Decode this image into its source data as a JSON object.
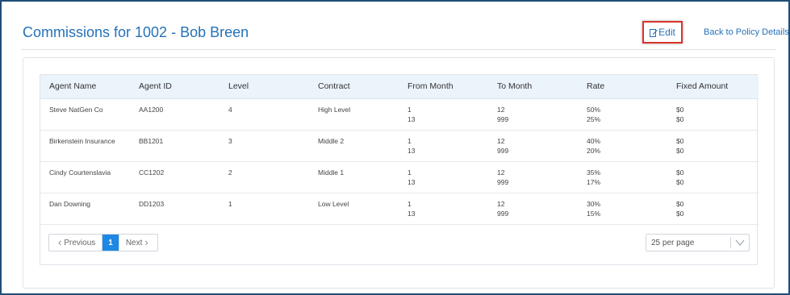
{
  "header": {
    "title": "Commissions for 1002 - Bob Breen",
    "edit_label": "Edit",
    "back_label": "Back to Policy Details"
  },
  "table": {
    "columns": [
      "Agent Name",
      "Agent ID",
      "Level",
      "Contract",
      "From Month",
      "To Month",
      "Rate",
      "Fixed Amount"
    ],
    "rows": [
      {
        "agent_name": "Steve NatGen Co",
        "agent_id": "AA1200",
        "level": "4",
        "contract": "High Level",
        "from": [
          "1",
          "13"
        ],
        "to": [
          "12",
          "999"
        ],
        "rate": [
          "50%",
          "25%"
        ],
        "fixed": [
          "$0",
          "$0"
        ]
      },
      {
        "agent_name": "Birkenstein Insurance",
        "agent_id": "BB1201",
        "level": "3",
        "contract": "Middle 2",
        "from": [
          "1",
          "13"
        ],
        "to": [
          "12",
          "999"
        ],
        "rate": [
          "40%",
          "20%"
        ],
        "fixed": [
          "$0",
          "$0"
        ]
      },
      {
        "agent_name": "Cindy Courtenslavia",
        "agent_id": "CC1202",
        "level": "2",
        "contract": "Middle 1",
        "from": [
          "1",
          "13"
        ],
        "to": [
          "12",
          "999"
        ],
        "rate": [
          "35%",
          "17%"
        ],
        "fixed": [
          "$0",
          "$0"
        ]
      },
      {
        "agent_name": "Dan Downing",
        "agent_id": "DD1203",
        "level": "1",
        "contract": "Low Level",
        "from": [
          "1",
          "13"
        ],
        "to": [
          "12",
          "999"
        ],
        "rate": [
          "30%",
          "15%"
        ],
        "fixed": [
          "$0",
          "$0"
        ]
      }
    ]
  },
  "pagination": {
    "previous_label": "Previous",
    "current_page": "1",
    "next_label": "Next",
    "per_page": "25 per page"
  },
  "colors": {
    "accent": "#2672b8",
    "active_page": "#1e88e5",
    "highlight_border": "#d9342b",
    "header_row": "#ebf3fb",
    "frame_border": "#1f4e79"
  },
  "icons": {
    "edit": "edit-icon",
    "previous": "chevron-left-icon",
    "next": "chevron-right-icon",
    "dropdown": "chevron-down-icon"
  }
}
